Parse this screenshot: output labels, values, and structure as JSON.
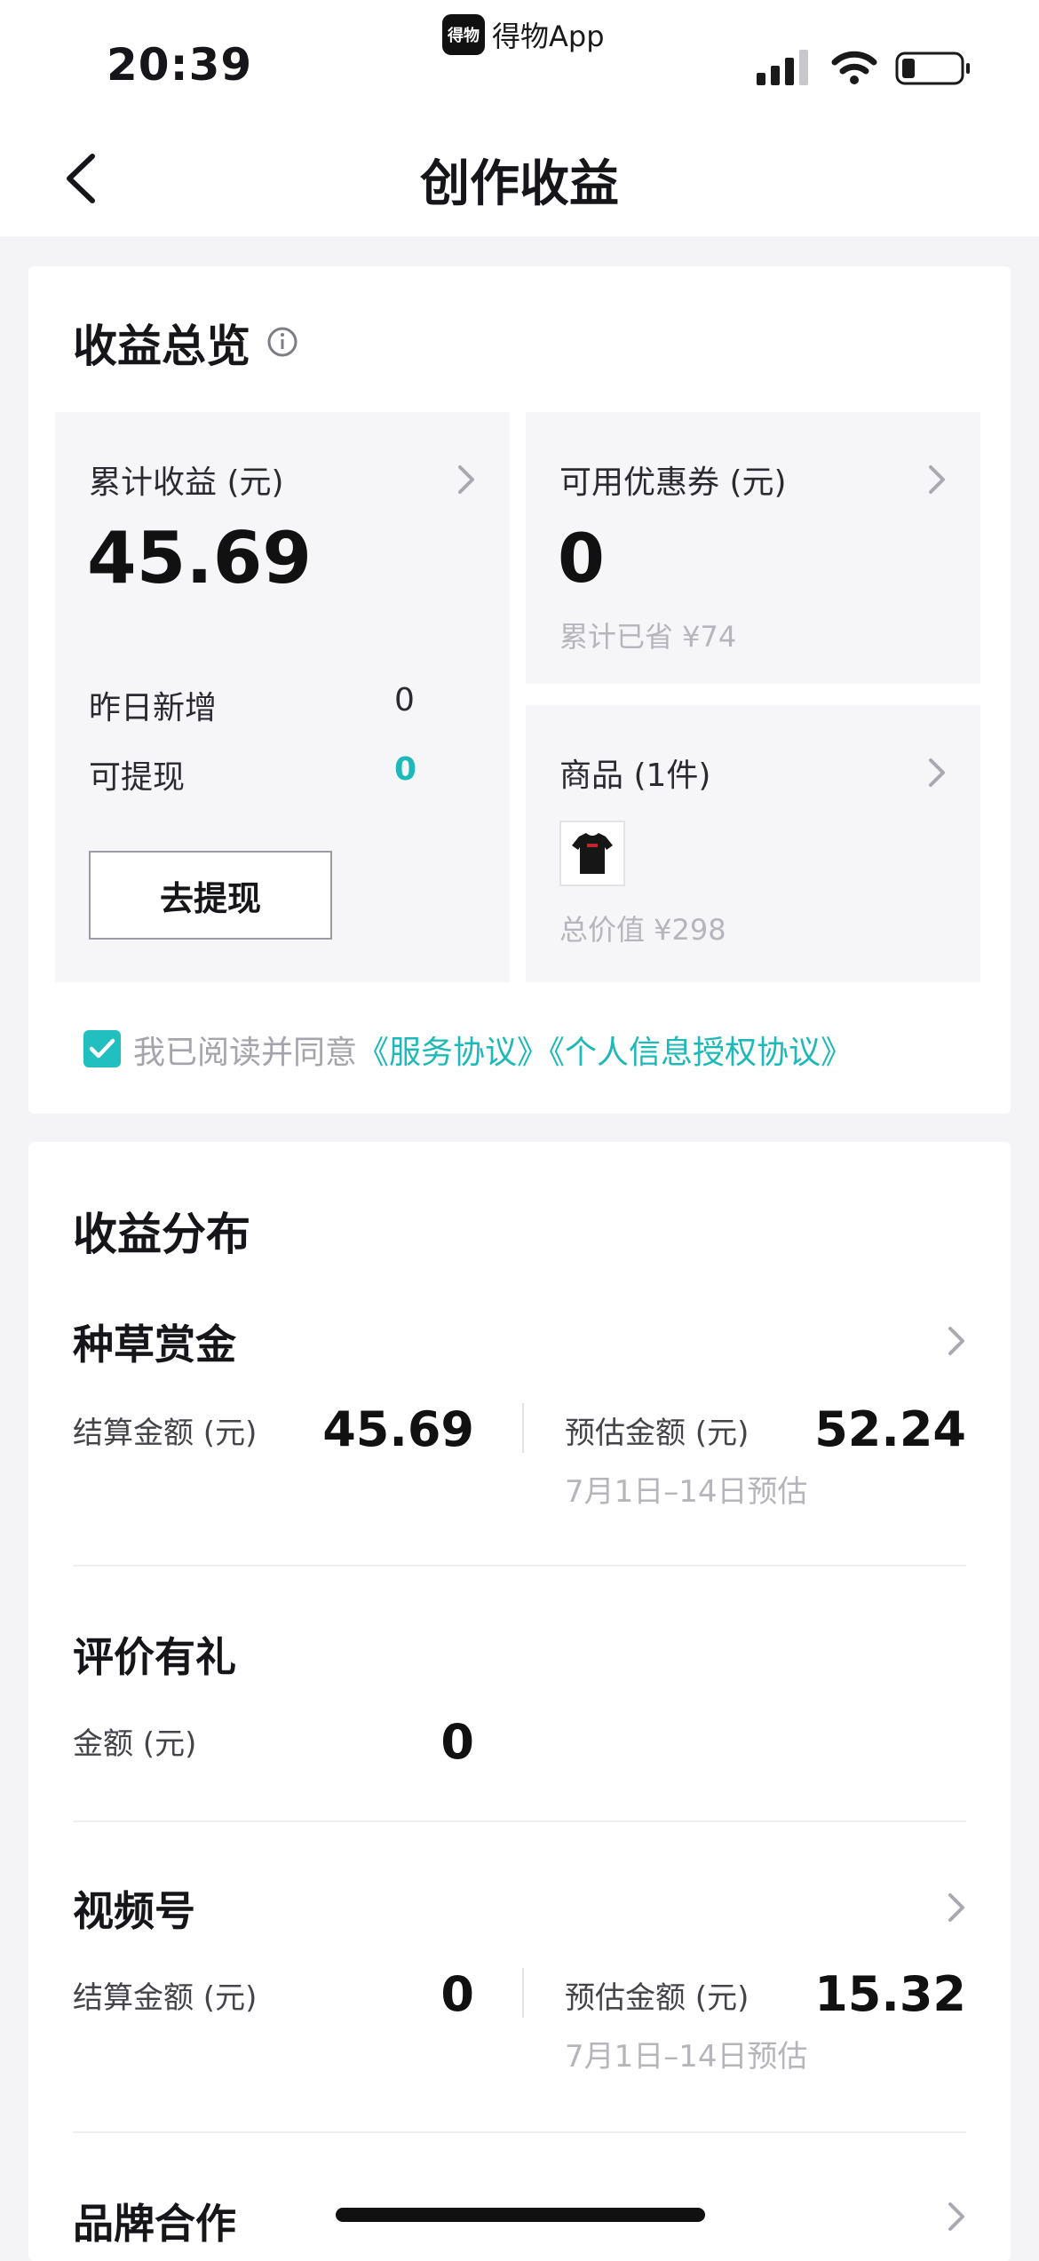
{
  "status_bar": {
    "time": "20:39",
    "app_badge_text": "得物App",
    "logo_text": "得物"
  },
  "nav": {
    "title": "创作收益"
  },
  "overview": {
    "title": "收益总览",
    "cumulative": {
      "label": "累计收益 (元)",
      "value": "45.69",
      "yesterday_label": "昨日新增",
      "yesterday_value": "0",
      "withdrawable_label": "可提现",
      "withdrawable_value": "0",
      "withdraw_button": "去提现"
    },
    "coupons": {
      "label": "可用优惠券 (元)",
      "value": "0",
      "saved_text": "累计已省 ¥74"
    },
    "products": {
      "label": "商品 (1件)",
      "total_text": "总价值 ¥298"
    },
    "agreement": {
      "prefix": "我已阅读并同意",
      "service": "《服务协议》",
      "privacy": "《个人信息授权协议》"
    }
  },
  "distribution": {
    "title": "收益分布",
    "items": [
      {
        "name": "种草赏金",
        "settled_label": "结算金额 (元)",
        "settled_value": "45.69",
        "est_label": "预估金额 (元)",
        "est_value": "52.24",
        "est_note": "7月1日–14日预估"
      },
      {
        "name": "评价有礼",
        "amount_label": "金额 (元)",
        "amount_value": "0"
      },
      {
        "name": "视频号",
        "settled_label": "结算金额 (元)",
        "settled_value": "0",
        "est_label": "预估金额 (元)",
        "est_value": "15.32",
        "est_note": "7月1日–14日预估"
      },
      {
        "name": "品牌合作"
      }
    ]
  }
}
